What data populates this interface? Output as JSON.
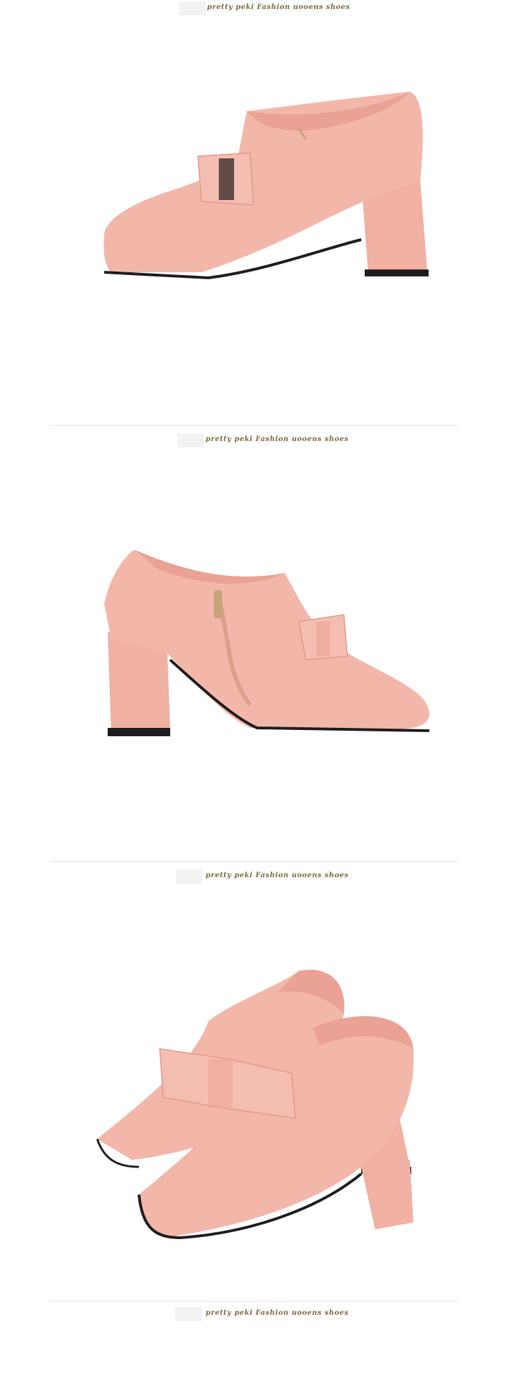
{
  "banners": [
    {
      "text": "pretty peki Fashion uooens shoes"
    },
    {
      "text": "pretty peki Fashion uooens shoes"
    },
    {
      "text": "pretty peki Fashion uooens shoes"
    },
    {
      "text": "pretty peki Fashion uooens shoes"
    }
  ],
  "images": [
    {
      "icon": "shoe-side-view-left-icon"
    },
    {
      "icon": "shoe-side-view-right-icon"
    },
    {
      "icon": "shoe-pair-front-view-icon"
    }
  ],
  "colors": {
    "leather": "#f3b7aa",
    "leather_shade": "#e29b8e",
    "sole": "#1d1d1d",
    "banner_text": "#7a6a3e"
  }
}
